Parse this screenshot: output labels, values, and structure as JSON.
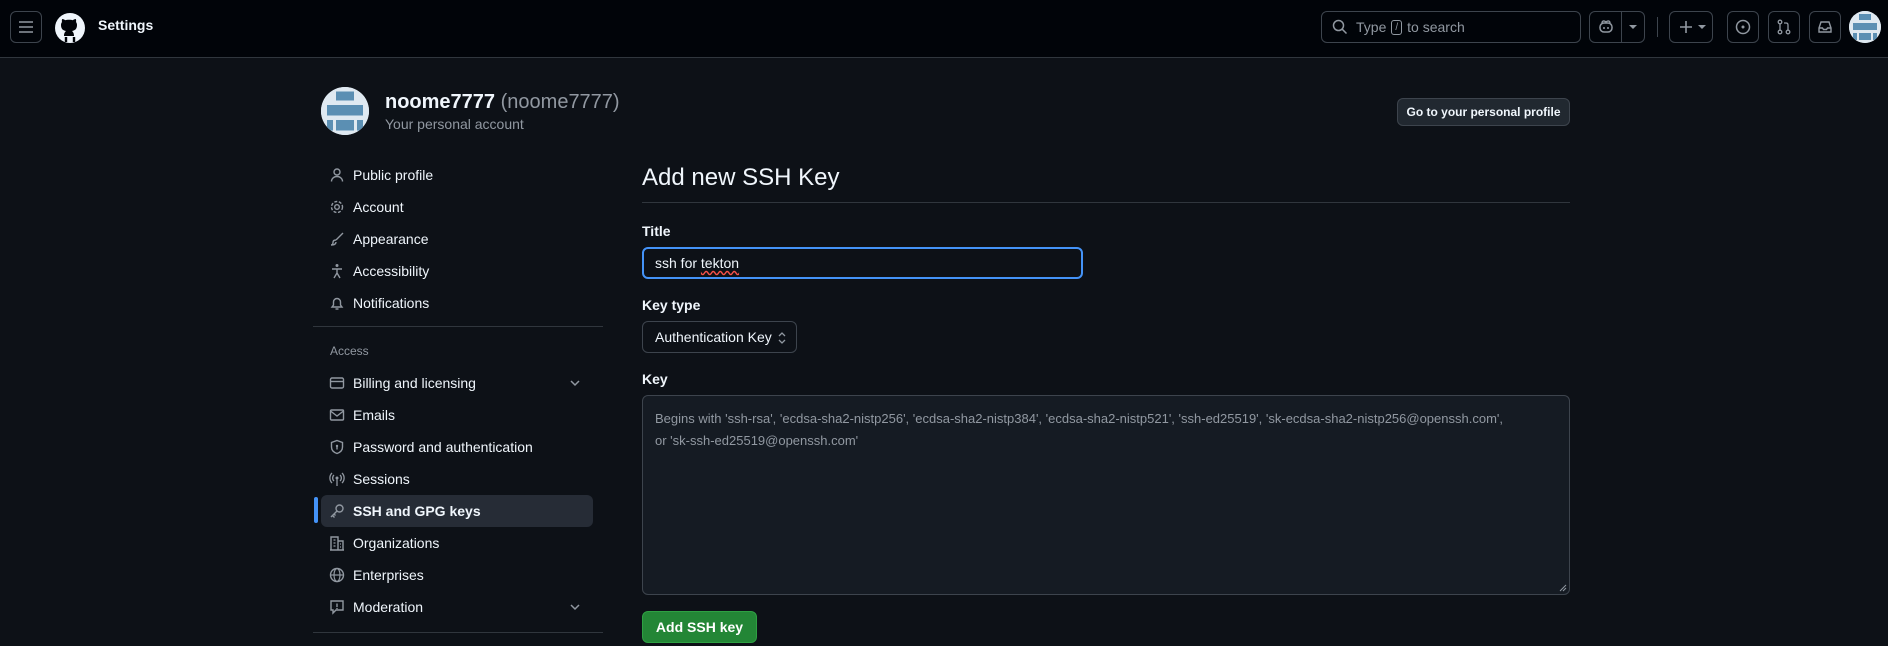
{
  "header": {
    "context_title": "Settings",
    "search_prefix": "Type",
    "search_key": "/",
    "search_suffix": "to search"
  },
  "account": {
    "username": "noome7777",
    "handle": "(noome7777)",
    "subtitle": "Your personal account",
    "profile_button": "Go to your personal profile"
  },
  "sidebar": {
    "items_top": [
      {
        "label": "Public profile",
        "icon": "person-icon"
      },
      {
        "label": "Account",
        "icon": "gear-icon"
      },
      {
        "label": "Appearance",
        "icon": "paintbrush-icon"
      },
      {
        "label": "Accessibility",
        "icon": "accessibility-icon"
      },
      {
        "label": "Notifications",
        "icon": "bell-icon"
      }
    ],
    "group_label": "Access",
    "items_access": [
      {
        "label": "Billing and licensing",
        "icon": "credit-card-icon",
        "expandable": true
      },
      {
        "label": "Emails",
        "icon": "mail-icon"
      },
      {
        "label": "Password and authentication",
        "icon": "shield-lock-icon"
      },
      {
        "label": "Sessions",
        "icon": "broadcast-icon"
      },
      {
        "label": "SSH and GPG keys",
        "icon": "key-icon",
        "active": true
      },
      {
        "label": "Organizations",
        "icon": "organization-icon"
      },
      {
        "label": "Enterprises",
        "icon": "globe-icon"
      },
      {
        "label": "Moderation",
        "icon": "report-icon",
        "expandable": true
      }
    ]
  },
  "form": {
    "heading": "Add new SSH Key",
    "title_label": "Title",
    "title_value_part1": "ssh for ",
    "title_value_part2": "tekton",
    "key_type_label": "Key type",
    "key_type_value": "Authentication Key",
    "key_label": "Key",
    "key_placeholder_line1": "Begins with 'ssh-rsa', 'ecdsa-sha2-nistp256', 'ecdsa-sha2-nistp384', 'ecdsa-sha2-nistp521', 'ssh-ed25519', 'sk-ecdsa-sha2-nistp256@openssh.com',",
    "key_placeholder_line2": "or 'sk-ssh-ed25519@openssh.com'",
    "submit_label": "Add SSH key"
  },
  "colors": {
    "background": "#0d1117",
    "header": "#010409",
    "accent": "#4493f8",
    "primary_button": "#238636"
  }
}
